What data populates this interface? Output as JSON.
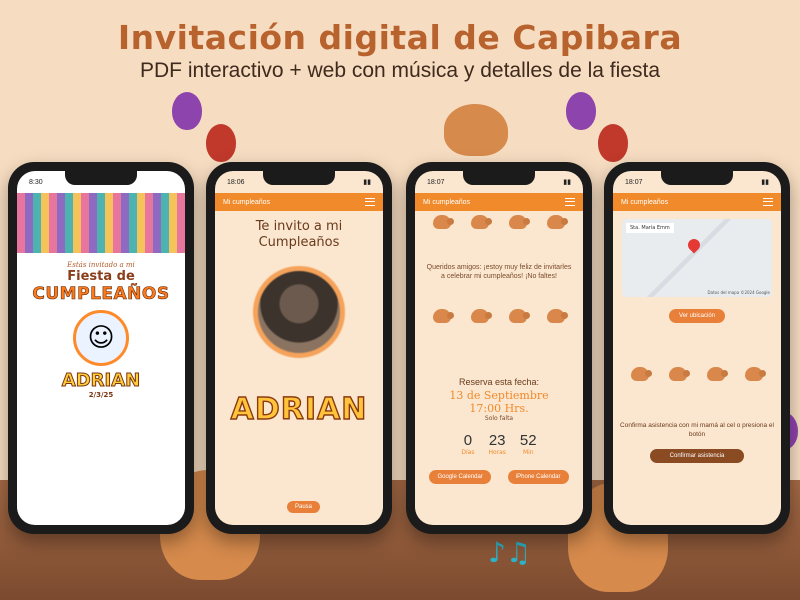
{
  "header": {
    "title": "Invitación digital de Capibara",
    "subtitle": "PDF interactivo + web con música y detalles de la fiesta"
  },
  "phone1": {
    "time": "8:30",
    "pre_title": "Estás invitado a mi",
    "fiesta": "Fiesta de",
    "cumple": "CUMPLEAÑOS",
    "name": "ADRIAN",
    "date": "2/3/25"
  },
  "phone2": {
    "time": "18:06",
    "app_title": "Mi cumpleaños",
    "invite": "Te invito a mi Cumpleaños",
    "name": "ADRIAN",
    "pause": "Pausa"
  },
  "phone3": {
    "time": "18:07",
    "app_title": "Mi cumpleaños",
    "message": "Queridos amigos: ¡estoy muy feliz de invitarles a celebrar mi cumpleaños! ¡No faltes!",
    "reserve": "Reserva esta fecha:",
    "date": "13 de Septiembre",
    "time_label": "17:00 Hrs.",
    "solo": "Solo falta",
    "countdown": [
      {
        "num": "0",
        "label": "Días"
      },
      {
        "num": "23",
        "label": "Horas"
      },
      {
        "num": "52",
        "label": "Min"
      }
    ],
    "google": "Google Calendar",
    "iphone": "iPhone Calendar"
  },
  "phone4": {
    "time": "18:07",
    "app_title": "Mi cumpleaños",
    "map_addr": "Sta. María Emm",
    "map_attr": "Datos del mapa ©2024 Google",
    "ver": "Ver ubicación",
    "confirm": "Confirma asistencia con mi mamá al cel o presiona el botón",
    "confirm_btn": "Confirmar asistencia"
  },
  "colors": {
    "accent": "#f08a2b",
    "title": "#b8622e",
    "background": "#f6dcc0"
  }
}
